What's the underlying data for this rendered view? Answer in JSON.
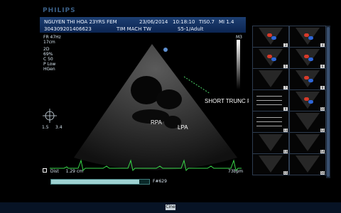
{
  "brand": "PHILIPS",
  "header": {
    "patient": "NGUYEN THI HOA 23YRS FEM",
    "date": "23/06/2014",
    "time": "10:18:10",
    "tis": "TIS0.7",
    "mi": "MI 1.4",
    "id": "304309201406623",
    "department": "TIM MACH TW",
    "probe": "S5-1/Adult"
  },
  "settings": {
    "fr": "FR 47Hz",
    "depth": "17cm",
    "mode": "2D",
    "gain": "69%",
    "compress": "C 50",
    "power": "P Low",
    "freq": "HGen",
    "m3": "M3"
  },
  "measurement": {
    "label": "Dist",
    "value": "1.29 cm"
  },
  "heart_rate": "73bpm",
  "frame_counter": "F#629",
  "scale_marks": [
    "1.5",
    "3.4"
  ],
  "annotations": {
    "short_trunc": "SHORT TRUNC PA",
    "rpa": "RPA",
    "lpa": "LPA"
  },
  "cine_progress": 0.9,
  "thumbnails": [
    {
      "num": "3",
      "type": "color"
    },
    {
      "num": "4",
      "type": "color"
    },
    {
      "num": "5",
      "type": "color"
    },
    {
      "num": "6",
      "type": "color"
    },
    {
      "num": "7",
      "type": "2d"
    },
    {
      "num": "8",
      "type": "color"
    },
    {
      "num": "9",
      "type": "doppler"
    },
    {
      "num": "10",
      "type": "color"
    },
    {
      "num": "11",
      "type": "doppler"
    },
    {
      "num": "12",
      "type": "2d"
    },
    {
      "num": "13",
      "type": "2d"
    },
    {
      "num": "14",
      "type": "2d"
    },
    {
      "num": "15",
      "type": "2d"
    },
    {
      "num": "16",
      "type": "2d"
    }
  ],
  "bottom_button": "Cine",
  "colors": {
    "header_top": "#1d3f72",
    "header_bottom": "#0c2552",
    "ecg": "#39d94a",
    "overlay_green": "#4cd96a",
    "dist_marker": "#ffffff"
  }
}
